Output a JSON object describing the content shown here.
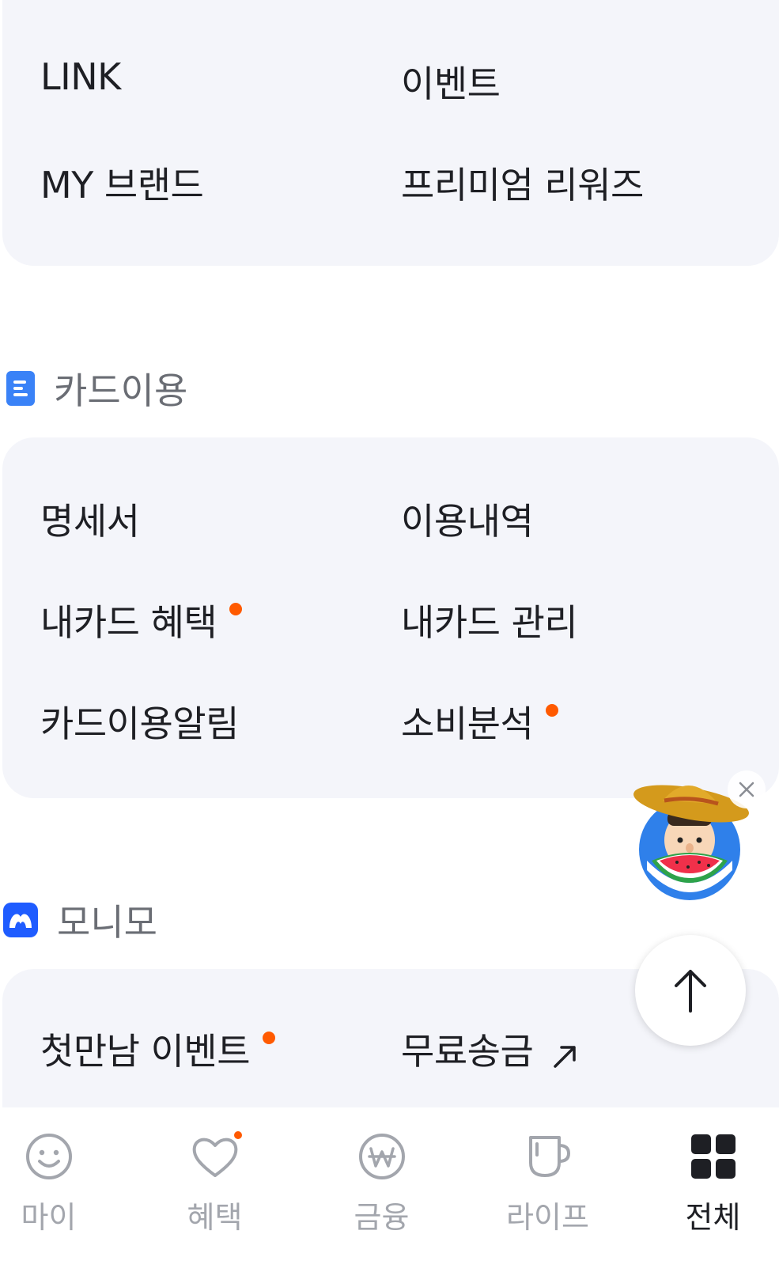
{
  "top_menu": {
    "items": [
      {
        "label": "LINK",
        "dot": false
      },
      {
        "label": "이벤트",
        "dot": false
      },
      {
        "label": "MY 브랜드",
        "dot": false
      },
      {
        "label": "프리미엄 리워즈",
        "dot": false
      }
    ]
  },
  "card_section": {
    "title": "카드이용",
    "icon": "document-icon",
    "items": [
      {
        "label": "명세서",
        "dot": false
      },
      {
        "label": "이용내역",
        "dot": false
      },
      {
        "label": "내카드 혜택",
        "dot": true
      },
      {
        "label": "내카드 관리",
        "dot": false
      },
      {
        "label": "카드이용알림",
        "dot": false
      },
      {
        "label": "소비분석",
        "dot": true
      }
    ]
  },
  "monimo_section": {
    "title": "모니모",
    "icon": "monimo-logo-icon",
    "items": [
      {
        "label": "첫만남 이벤트",
        "dot": true
      },
      {
        "label": "무료송금",
        "external": true
      }
    ]
  },
  "floating": {
    "promo_icon": "farmer-watermelon-character",
    "close_icon": "close-icon",
    "scroll_top_icon": "arrow-up-icon"
  },
  "tabbar": {
    "tabs": [
      {
        "label": "마이",
        "icon": "smiley-icon",
        "active": false,
        "dot": false
      },
      {
        "label": "혜택",
        "icon": "heart-icon",
        "active": false,
        "dot": true
      },
      {
        "label": "금융",
        "icon": "won-coin-icon",
        "active": false,
        "dot": false
      },
      {
        "label": "라이프",
        "icon": "cup-icon",
        "active": false,
        "dot": false
      },
      {
        "label": "전체",
        "icon": "grid-icon",
        "active": true,
        "dot": false
      }
    ]
  },
  "colors": {
    "accent_dot": "#ff5a00",
    "panel_bg": "#f4f5fa",
    "monimo_blue": "#1f5cff",
    "doc_blue": "#3a82f7"
  }
}
